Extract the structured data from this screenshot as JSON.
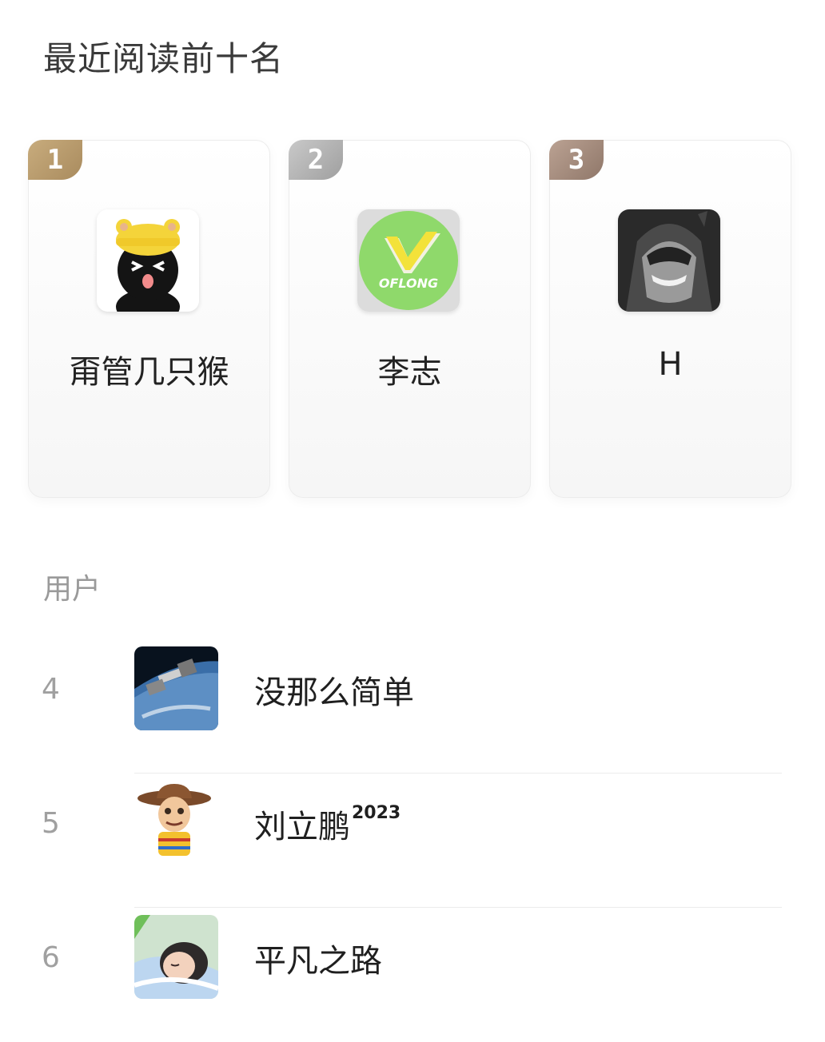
{
  "header": {
    "title": "最近阅读前十名"
  },
  "podium": [
    {
      "rank": "1",
      "name": "甭管几只猴",
      "avatar": "cat-with-yellow-hat-avatar"
    },
    {
      "rank": "2",
      "name": "李志",
      "avatar": "oflong-logo-avatar",
      "avatar_text": "OFLONG"
    },
    {
      "rank": "3",
      "name": "H",
      "avatar": "dark-hooded-figure-avatar"
    }
  ],
  "section": {
    "label": "用户"
  },
  "list": [
    {
      "rank": "4",
      "name": "没那么简单",
      "suffix": "",
      "avatar": "space-station-avatar"
    },
    {
      "rank": "5",
      "name": "刘立鹏",
      "suffix": "2023",
      "avatar": "cowboy-toy-avatar"
    },
    {
      "rank": "6",
      "name": "平凡之路",
      "suffix": "",
      "avatar": "sleeping-cartoon-avatar"
    }
  ],
  "colors": {
    "gold": "#b39467",
    "silver": "#b5b5b5",
    "bronze": "#a58b7d",
    "muted_text": "#9a9a9a"
  }
}
